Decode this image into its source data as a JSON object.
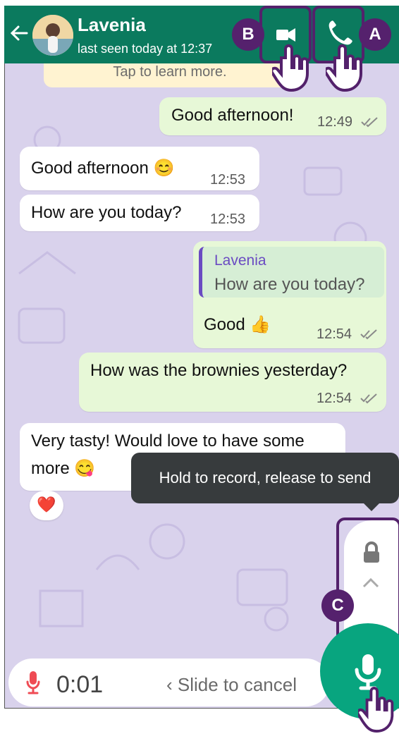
{
  "header": {
    "contact_name": "Lavenia",
    "status": "last seen today at 12:37"
  },
  "notice": {
    "text": "Tap to learn more."
  },
  "messages": [
    {
      "direction": "out",
      "text": "Good afternoon!",
      "time": "12:49"
    },
    {
      "direction": "in",
      "text": "Good afternoon 😊",
      "time": "12:53"
    },
    {
      "direction": "in",
      "text": "How are you today?",
      "time": "12:53"
    },
    {
      "direction": "out",
      "quote_author": "Lavenia",
      "quote_text": "How are you today?",
      "text": "Good 👍",
      "time": "12:54"
    },
    {
      "direction": "out",
      "text": "How was the brownies yesterday?",
      "time": "12:54"
    },
    {
      "direction": "in",
      "text_line1": "Very tasty! Would love to have some",
      "text_line2": "more 😋",
      "reaction": "❤️"
    }
  ],
  "tooltip": {
    "text": "Hold to record, release to send"
  },
  "composer": {
    "timer": "0:01",
    "slide_hint": "‹ Slide to cancel"
  },
  "annotations": {
    "a": "A",
    "b": "B",
    "c": "C"
  },
  "colors": {
    "header": "#0b7a5e",
    "annotation": "#55216d",
    "incoming": "#ffffff",
    "outgoing": "#e7f8d7",
    "mic": "#08a57f"
  },
  "icons": [
    "back-arrow-icon",
    "video-call-icon",
    "voice-call-icon",
    "lock-icon",
    "chevron-up-icon",
    "mic-icon",
    "pointer-hand-icon"
  ]
}
